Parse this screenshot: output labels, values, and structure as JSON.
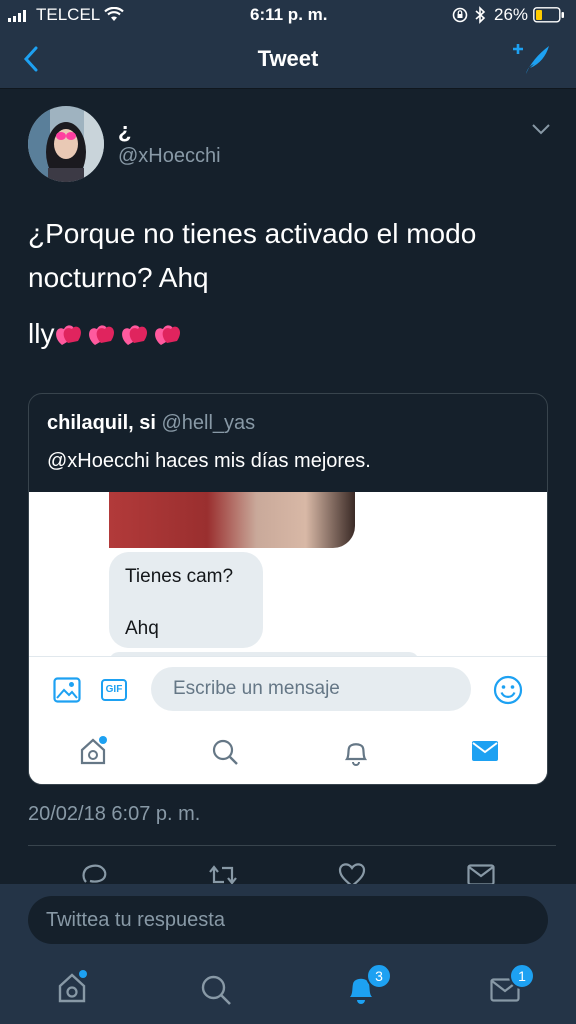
{
  "status_bar": {
    "carrier": "TELCEL",
    "time": "6:11 p. m.",
    "battery": "26%"
  },
  "nav": {
    "title": "Tweet"
  },
  "tweet": {
    "display_name": "¿",
    "handle": "@xHoecchi",
    "text": "¿Porque no tienes activado el modo nocturno? Ahq",
    "text2": "lly",
    "timestamp": "20/02/18 6:07 p. m."
  },
  "quoted_tweet": {
    "name": "chilaquil, si",
    "handle": "@hell_yas",
    "text": "@xHoecchi haces mis días mejores.",
    "screenshot": {
      "bubble_line1": "Tienes cam?",
      "bubble_line2": "Ahq",
      "gif_label": "GIF",
      "message_placeholder": "Escribe un mensaje"
    }
  },
  "reply": {
    "placeholder": "Twittea tu respuesta"
  },
  "tab_bar": {
    "notifications_badge": "3",
    "messages_badge": "1"
  },
  "colors": {
    "background": "#15202b",
    "panel": "#243447",
    "accent": "#1da1f2",
    "secondary_text": "#8899a6",
    "heart": "#e0245e"
  },
  "icons": [
    "wifi-icon",
    "bluetooth-icon",
    "battery-icon",
    "back-icon",
    "compose-tweet-icon",
    "chevron-down-icon",
    "sparkling-heart-icon",
    "image-icon",
    "emoji-icon",
    "home-icon",
    "search-icon",
    "bell-icon",
    "mail-icon",
    "reply-icon",
    "retweet-icon",
    "like-icon"
  ]
}
